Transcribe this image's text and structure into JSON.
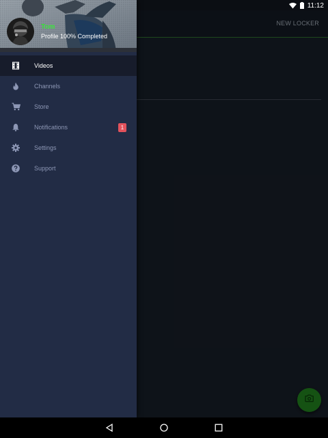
{
  "status_bar": {
    "time": "11:12",
    "icons": [
      "wifi-icon",
      "battery-icon"
    ]
  },
  "app": {
    "toolbar": {
      "action_label": "NEW LOCKER"
    },
    "fab": {
      "icon": "add-photo-icon",
      "color": "#1f7a1c"
    }
  },
  "drawer": {
    "header": {
      "user_name": "Tom",
      "profile_status": "Profile 100% Completed"
    },
    "items": [
      {
        "label": "Videos",
        "icon": "film-icon",
        "active": true
      },
      {
        "label": "Channels",
        "icon": "fire-icon",
        "active": false
      },
      {
        "label": "Store",
        "icon": "cart-icon",
        "active": false
      },
      {
        "label": "Notifications",
        "icon": "bell-icon",
        "active": false,
        "badge": "1"
      },
      {
        "label": "Settings",
        "icon": "gear-icon",
        "active": false
      },
      {
        "label": "Support",
        "icon": "help-icon",
        "active": false
      }
    ]
  },
  "nav_bar": {
    "buttons": [
      "back-icon",
      "home-icon",
      "recents-icon"
    ]
  },
  "colors": {
    "drawer_bg": "#222c45",
    "active_item_bg": "#171c2b",
    "user_name": "#39e33a",
    "badge": "#e2525c",
    "accent_line": "#2d6b2a"
  }
}
